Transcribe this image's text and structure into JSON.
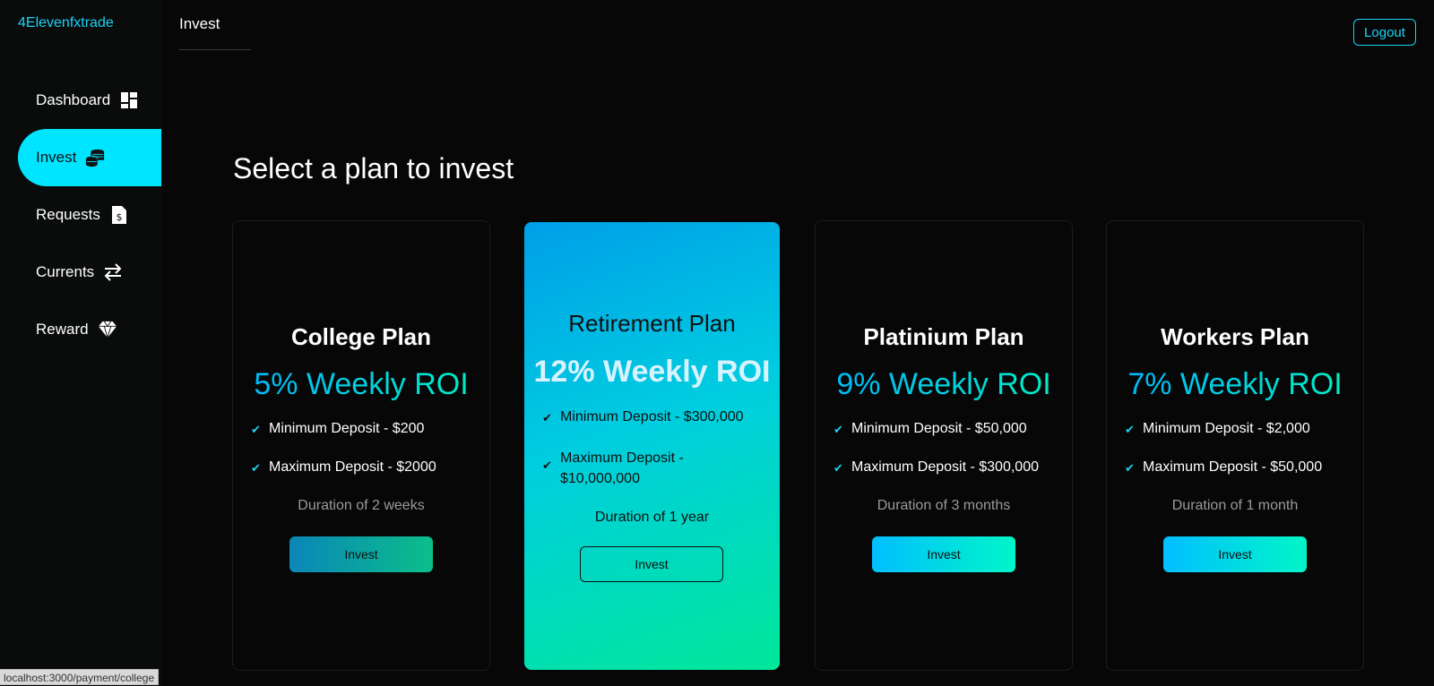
{
  "brand": "4Elevenfxtrade",
  "sidebar": {
    "items": [
      {
        "label": "Dashboard",
        "icon": "dashboard-grid-icon"
      },
      {
        "label": "Invest",
        "icon": "coins-stack-icon"
      },
      {
        "label": "Requests",
        "icon": "document-dollar-icon"
      },
      {
        "label": "Currents",
        "icon": "swap-arrows-icon"
      },
      {
        "label": "Reward",
        "icon": "diamond-icon"
      }
    ],
    "active": "Invest"
  },
  "topbar": {
    "title": "Invest",
    "logout_label": "Logout"
  },
  "main": {
    "heading": "Select a plan to invest",
    "plans": [
      {
        "name": "College Plan",
        "roi": "5% Weekly ROI",
        "min": "Minimum Deposit - $200",
        "max": "Maximum Deposit - $2000",
        "duration": "Duration of 2 weeks",
        "button": "Invest"
      },
      {
        "name": "Retirement Plan",
        "roi": "12% Weekly ROI",
        "min": "Minimum Deposit - $300,000",
        "max": "Maximum Deposit - $10,000,000",
        "duration": "Duration of 1 year",
        "button": "Invest"
      },
      {
        "name": "Platinium Plan",
        "roi": "9% Weekly ROI",
        "min": "Minimum Deposit - $50,000",
        "max": "Maximum Deposit - $300,000",
        "duration": "Duration of 3 months",
        "button": "Invest"
      },
      {
        "name": "Workers Plan",
        "roi": "7% Weekly ROI",
        "min": "Minimum Deposit - $2,000",
        "max": "Maximum Deposit - $50,000",
        "duration": "Duration of 1 month",
        "button": "Invest"
      }
    ]
  },
  "status_bar": {
    "url": "localhost:3000/payment/college"
  },
  "colors": {
    "accent": "#00e5ff",
    "background": "#070707",
    "sidebar": "#0a0c0c"
  }
}
